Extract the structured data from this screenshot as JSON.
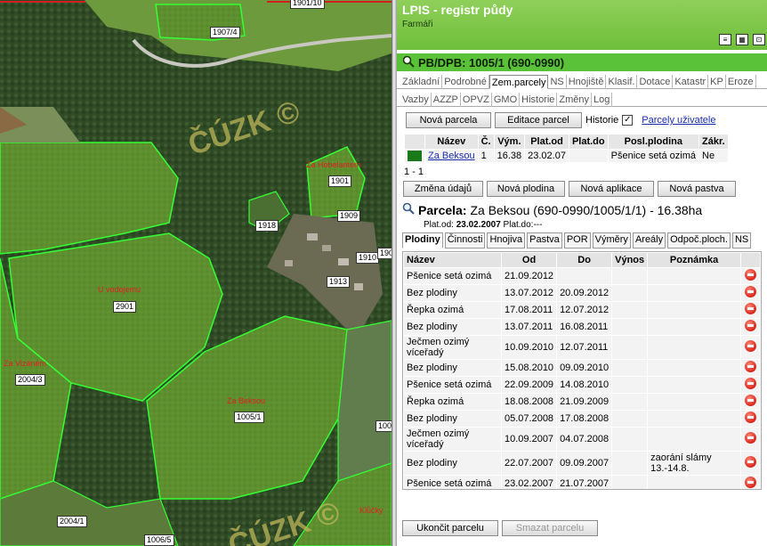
{
  "map": {
    "watermark": "ČÚZK ©",
    "parcel_labels": [
      "1907/4",
      "1901/10",
      "1901",
      "1909",
      "1918",
      "1910",
      "190",
      "1913",
      "2901",
      "2004/3",
      "1005/1",
      "100",
      "2004/1",
      "1006/5"
    ],
    "parcel_names": [
      "Za Hobelantem",
      "U vodojemu",
      "Za Vizáném",
      "Za Beksou",
      "Klůčky"
    ]
  },
  "header": {
    "title": "LPIS - registr půdy",
    "subtitle": "Farmáři",
    "pb_title": "PB/DPB: 1005/1 (690-0990)"
  },
  "tabs": {
    "row1": [
      "Základní",
      "Podrobné",
      "Zem.parcely",
      "NS",
      "Hnojiště",
      "Klasif.",
      "Dotace",
      "Katastr",
      "KP",
      "Eroze"
    ],
    "row2": [
      "Vazby",
      "AZZP",
      "OPVZ",
      "GMO",
      "Historie",
      "Změny",
      "Log"
    ],
    "active": "Zem.parcely"
  },
  "parcel_buttons": {
    "new_parcel": "Nová parcela",
    "edit_parcel": "Editace parcel",
    "history_label": "Historie",
    "history_checked": "✓",
    "user_parcels_link": "Parcely uživatele"
  },
  "parcel_table": {
    "headers": [
      "Název",
      "Č.",
      "Vým.",
      "Plat.od",
      "Plat.do",
      "Posl.plodina",
      "Zákr."
    ],
    "row": {
      "color": "#1a7a1a",
      "name": "Za Beksou",
      "number": "1",
      "area": "16.38",
      "valid_from": "23.02.07",
      "valid_to": "",
      "last_crop": "Pšenice setá ozimá",
      "limit": "Ne"
    },
    "paging": "1 - 1"
  },
  "action_buttons": [
    "Změna údajů",
    "Nová plodina",
    "Nová aplikace",
    "Nová pastva"
  ],
  "plot": {
    "label": "Parcela:",
    "value": "Za Beksou (690-0990/1005/1/1) - 16.38ha",
    "valid_from_label": "Plat.od:",
    "valid_from": "23.02.2007",
    "valid_to_label": "Plat.do:",
    "valid_to": "---"
  },
  "subtabs": {
    "items": [
      "Plodiny",
      "Činnosti",
      "Hnojiva",
      "Pastva",
      "POR",
      "Výměry",
      "Areály",
      "Odpoč.ploch.",
      "NS"
    ],
    "active": "Plodiny"
  },
  "crops": {
    "headers": [
      "Název",
      "Od",
      "Do",
      "Výnos",
      "Poznámka"
    ],
    "rows": [
      {
        "name": "Pšenice setá ozimá",
        "from": "21.09.2012",
        "to": "",
        "yield": "",
        "note": ""
      },
      {
        "name": "Bez plodiny",
        "from": "13.07.2012",
        "to": "20.09.2012",
        "yield": "",
        "note": ""
      },
      {
        "name": "Řepka ozimá",
        "from": "17.08.2011",
        "to": "12.07.2012",
        "yield": "",
        "note": ""
      },
      {
        "name": "Bez plodiny",
        "from": "13.07.2011",
        "to": "16.08.2011",
        "yield": "",
        "note": ""
      },
      {
        "name": "Ječmen ozimý víceřadý",
        "from": "10.09.2010",
        "to": "12.07.2011",
        "yield": "",
        "note": ""
      },
      {
        "name": "Bez plodiny",
        "from": "15.08.2010",
        "to": "09.09.2010",
        "yield": "",
        "note": ""
      },
      {
        "name": "Pšenice setá ozimá",
        "from": "22.09.2009",
        "to": "14.08.2010",
        "yield": "",
        "note": ""
      },
      {
        "name": "Řepka ozimá",
        "from": "18.08.2008",
        "to": "21.09.2009",
        "yield": "",
        "note": ""
      },
      {
        "name": "Bez plodiny",
        "from": "05.07.2008",
        "to": "17.08.2008",
        "yield": "",
        "note": ""
      },
      {
        "name": "Ječmen ozimý víceřadý",
        "from": "10.09.2007",
        "to": "04.07.2008",
        "yield": "",
        "note": ""
      },
      {
        "name": "Bez plodiny",
        "from": "22.07.2007",
        "to": "09.09.2007",
        "yield": "",
        "note": "zaorání slámy 13.-14.8."
      },
      {
        "name": "Pšenice setá ozimá",
        "from": "23.02.2007",
        "to": "21.07.2007",
        "yield": "",
        "note": ""
      }
    ]
  },
  "bottom_buttons": {
    "finish": "Ukončit parcelu",
    "delete": "Smazat parcelu"
  }
}
